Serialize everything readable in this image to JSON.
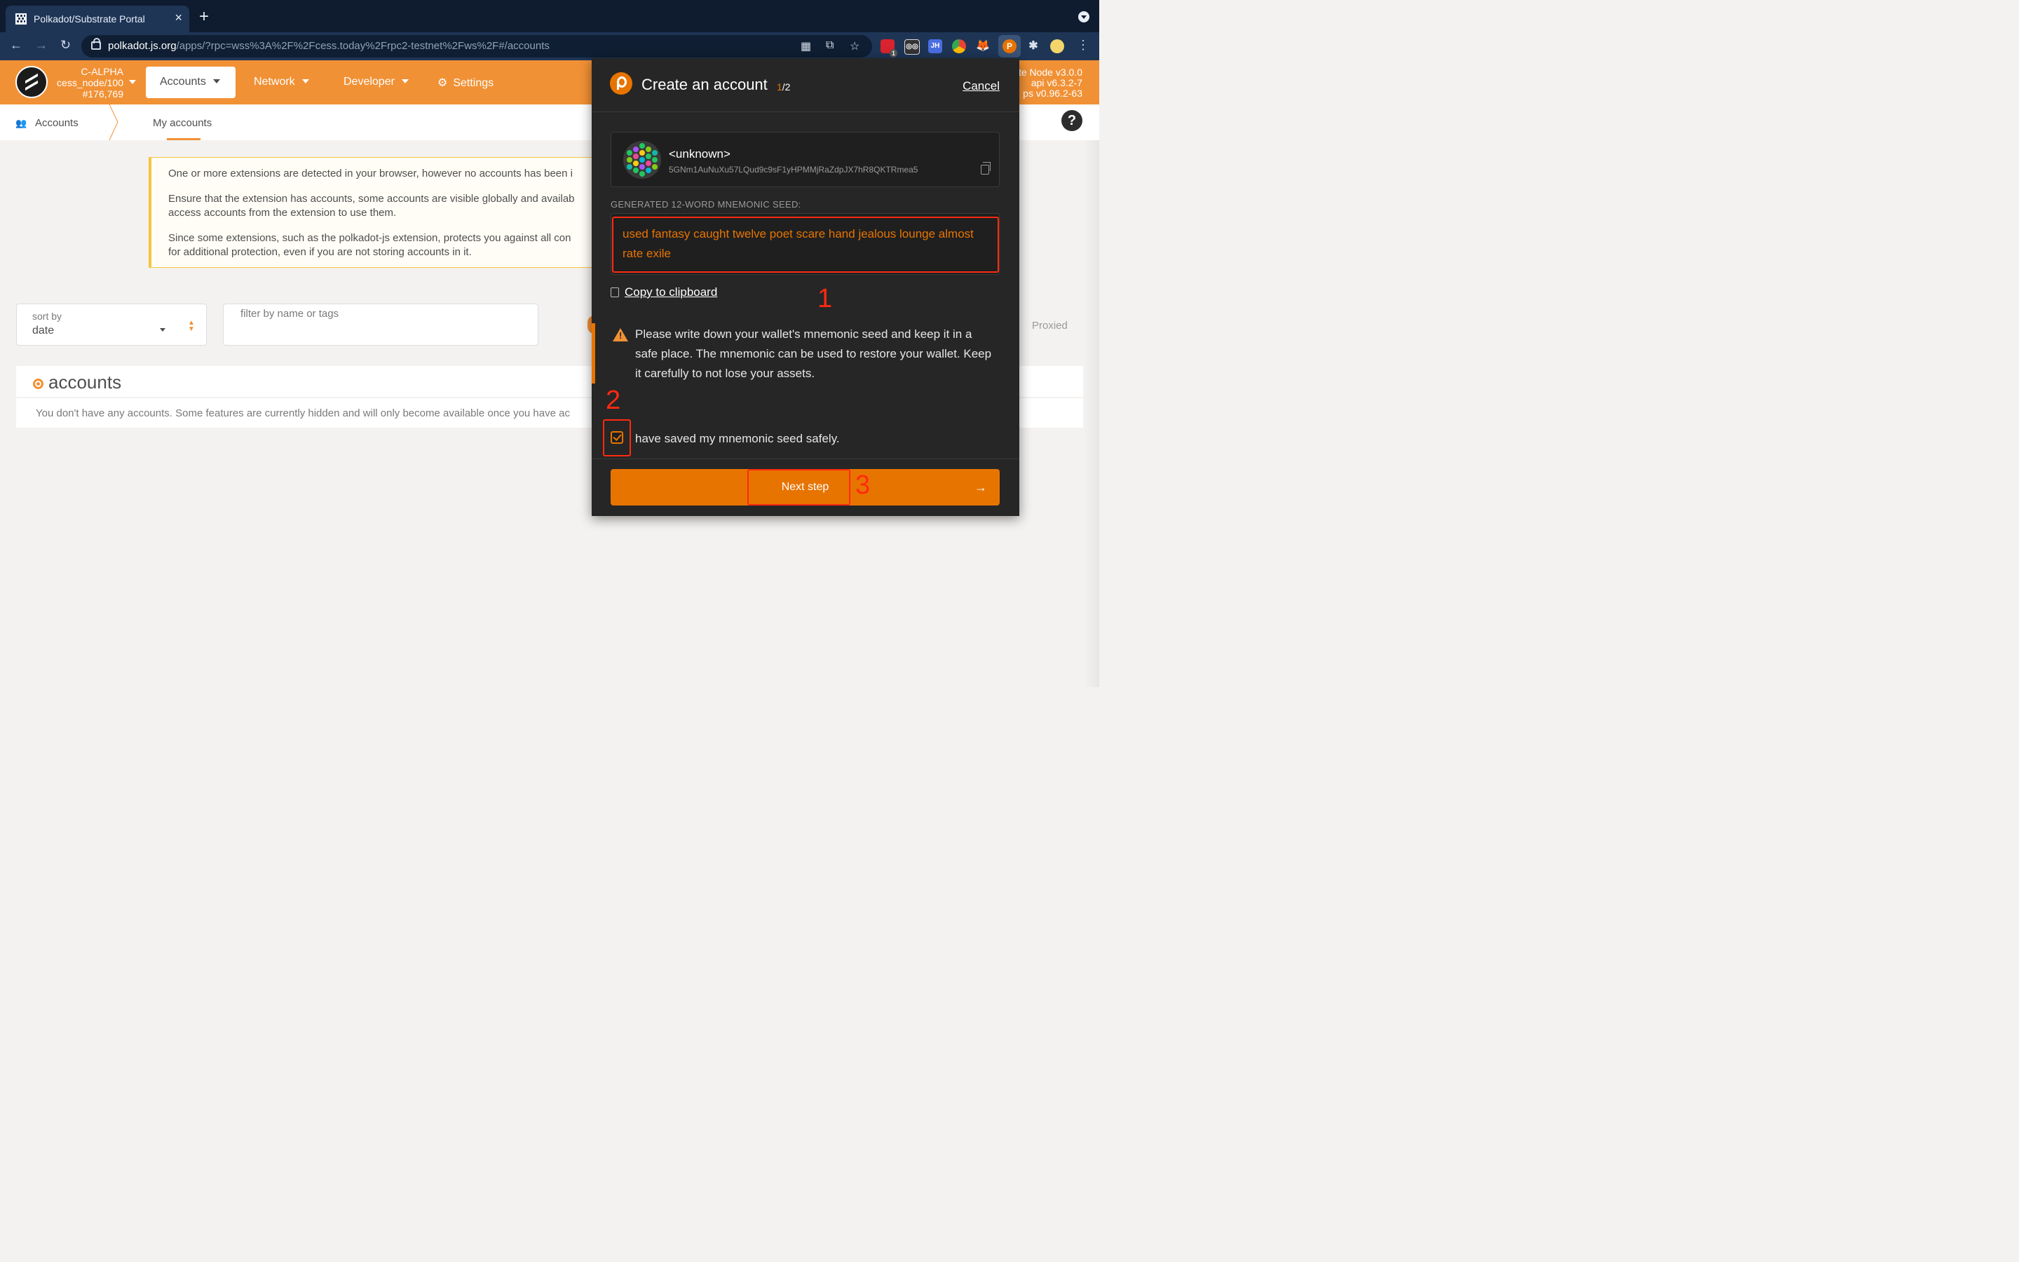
{
  "browser": {
    "tab_title": "Polkadot/Substrate Portal",
    "url_host": "polkadot.js.org",
    "url_path": "/apps/?rpc=wss%3A%2F%2Fcess.today%2Frpc2-testnet%2Fws%2F#/accounts",
    "extension_badge": "1",
    "extension_jh": "JH"
  },
  "header": {
    "chain_name": "C-ALPHA",
    "node": "cess_node/100",
    "block": "#176,769",
    "menu": {
      "accounts": "Accounts",
      "network": "Network",
      "developer": "Developer",
      "settings": "Settings"
    },
    "version_lines": [
      "te Node v3.0.0",
      "api v6.3.2-7",
      "ps v0.96.2-63"
    ]
  },
  "subnav": {
    "accounts": "Accounts",
    "my_accounts": "My accounts"
  },
  "notice": {
    "line1": "One or more extensions are detected in your browser, however no accounts has been i",
    "line2a": "Ensure that the extension has accounts, some accounts are visible globally and availab",
    "line2b": "access accounts from the extension to use them.",
    "line3a": "Since some extensions, such as the polkadot-js extension, protects you against all con",
    "line3b": "for additional protection, even if you are not storing accounts in it."
  },
  "controls": {
    "sort_label": "sort by",
    "sort_value": "date",
    "filter_placeholder": "filter by name or tags",
    "proxied": "Proxied"
  },
  "accounts_section": {
    "title": "accounts",
    "empty": "You don't have any accounts. Some features are currently hidden and will only become available once you have ac"
  },
  "popup": {
    "title": "Create an account",
    "step_current": "1",
    "step_total": "/2",
    "cancel": "Cancel",
    "account_name": "<unknown>",
    "account_address": "5GNm1AuNuXu57LQud9c9sF1yHPMMjRaZdpJX7hR8QKTRmea5",
    "seed_label": "GENERATED 12-WORD MNEMONIC SEED:",
    "seed": "used fantasy caught twelve poet scare hand jealous lounge almost rate exile",
    "copy": "Copy to clipboard",
    "warning": "Please write down your wallet's mnemonic seed and keep it in a safe place. The mnemonic can be used to restore your wallet. Keep it carefully to not lose your assets.",
    "checkbox_label": "have saved my mnemonic seed safely.",
    "checkbox_checked": true,
    "next": "Next step"
  },
  "annotations": [
    "1",
    "2",
    "3"
  ],
  "colors": {
    "accent": "#f19135",
    "extension_orange": "#e87400",
    "highlight": "#ff2a10",
    "popup_bg": "#262626"
  }
}
